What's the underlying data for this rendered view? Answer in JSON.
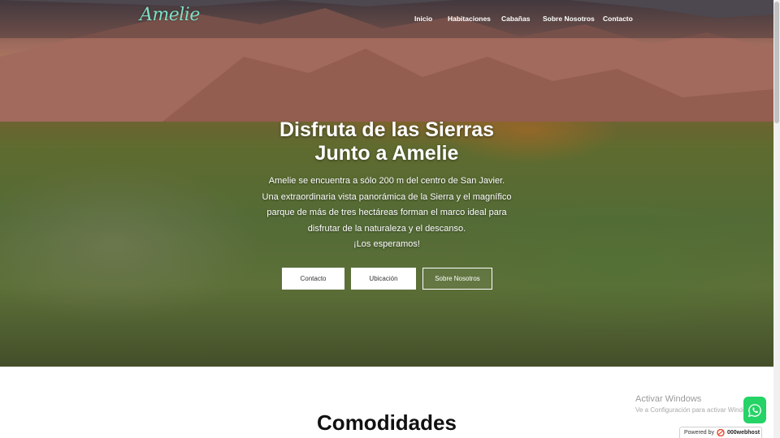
{
  "nav": {
    "logo": "Amelie",
    "links": [
      "Inicio",
      "Habitaciones",
      "Cabañas",
      "Sobre Nosotros",
      "Contacto"
    ]
  },
  "hero": {
    "title_line1": "Disfruta de las Sierras",
    "title_line2": "Junto a Amelie",
    "description": "Amelie se encuentra a sólo 200 m del centro de San Javier. Una extraordinaria vista panorámica de la Sierra y el magnífico parque de más de tres hectáreas forman el marco ideal para disfrutar de la naturaleza y el descanso.",
    "cta_text": "¡Los esperamos!",
    "buttons": [
      "Contacto",
      "Ubicación",
      "Sobre Nosotros"
    ]
  },
  "section": {
    "title": "Comodidades"
  },
  "overlay": {
    "windows_title": "Activar Windows",
    "windows_sub": "Ve a Configuración para activar Windows.",
    "powered_by": "Powered by",
    "powered_brand": "000webhost"
  },
  "colors": {
    "whatsapp": "#25d366",
    "logo": "#7fe0c8",
    "nav_bg": "rgba(40,35,40,0.35)"
  },
  "icons": [
    "whatsapp-icon",
    "000webhost-logo-icon"
  ]
}
